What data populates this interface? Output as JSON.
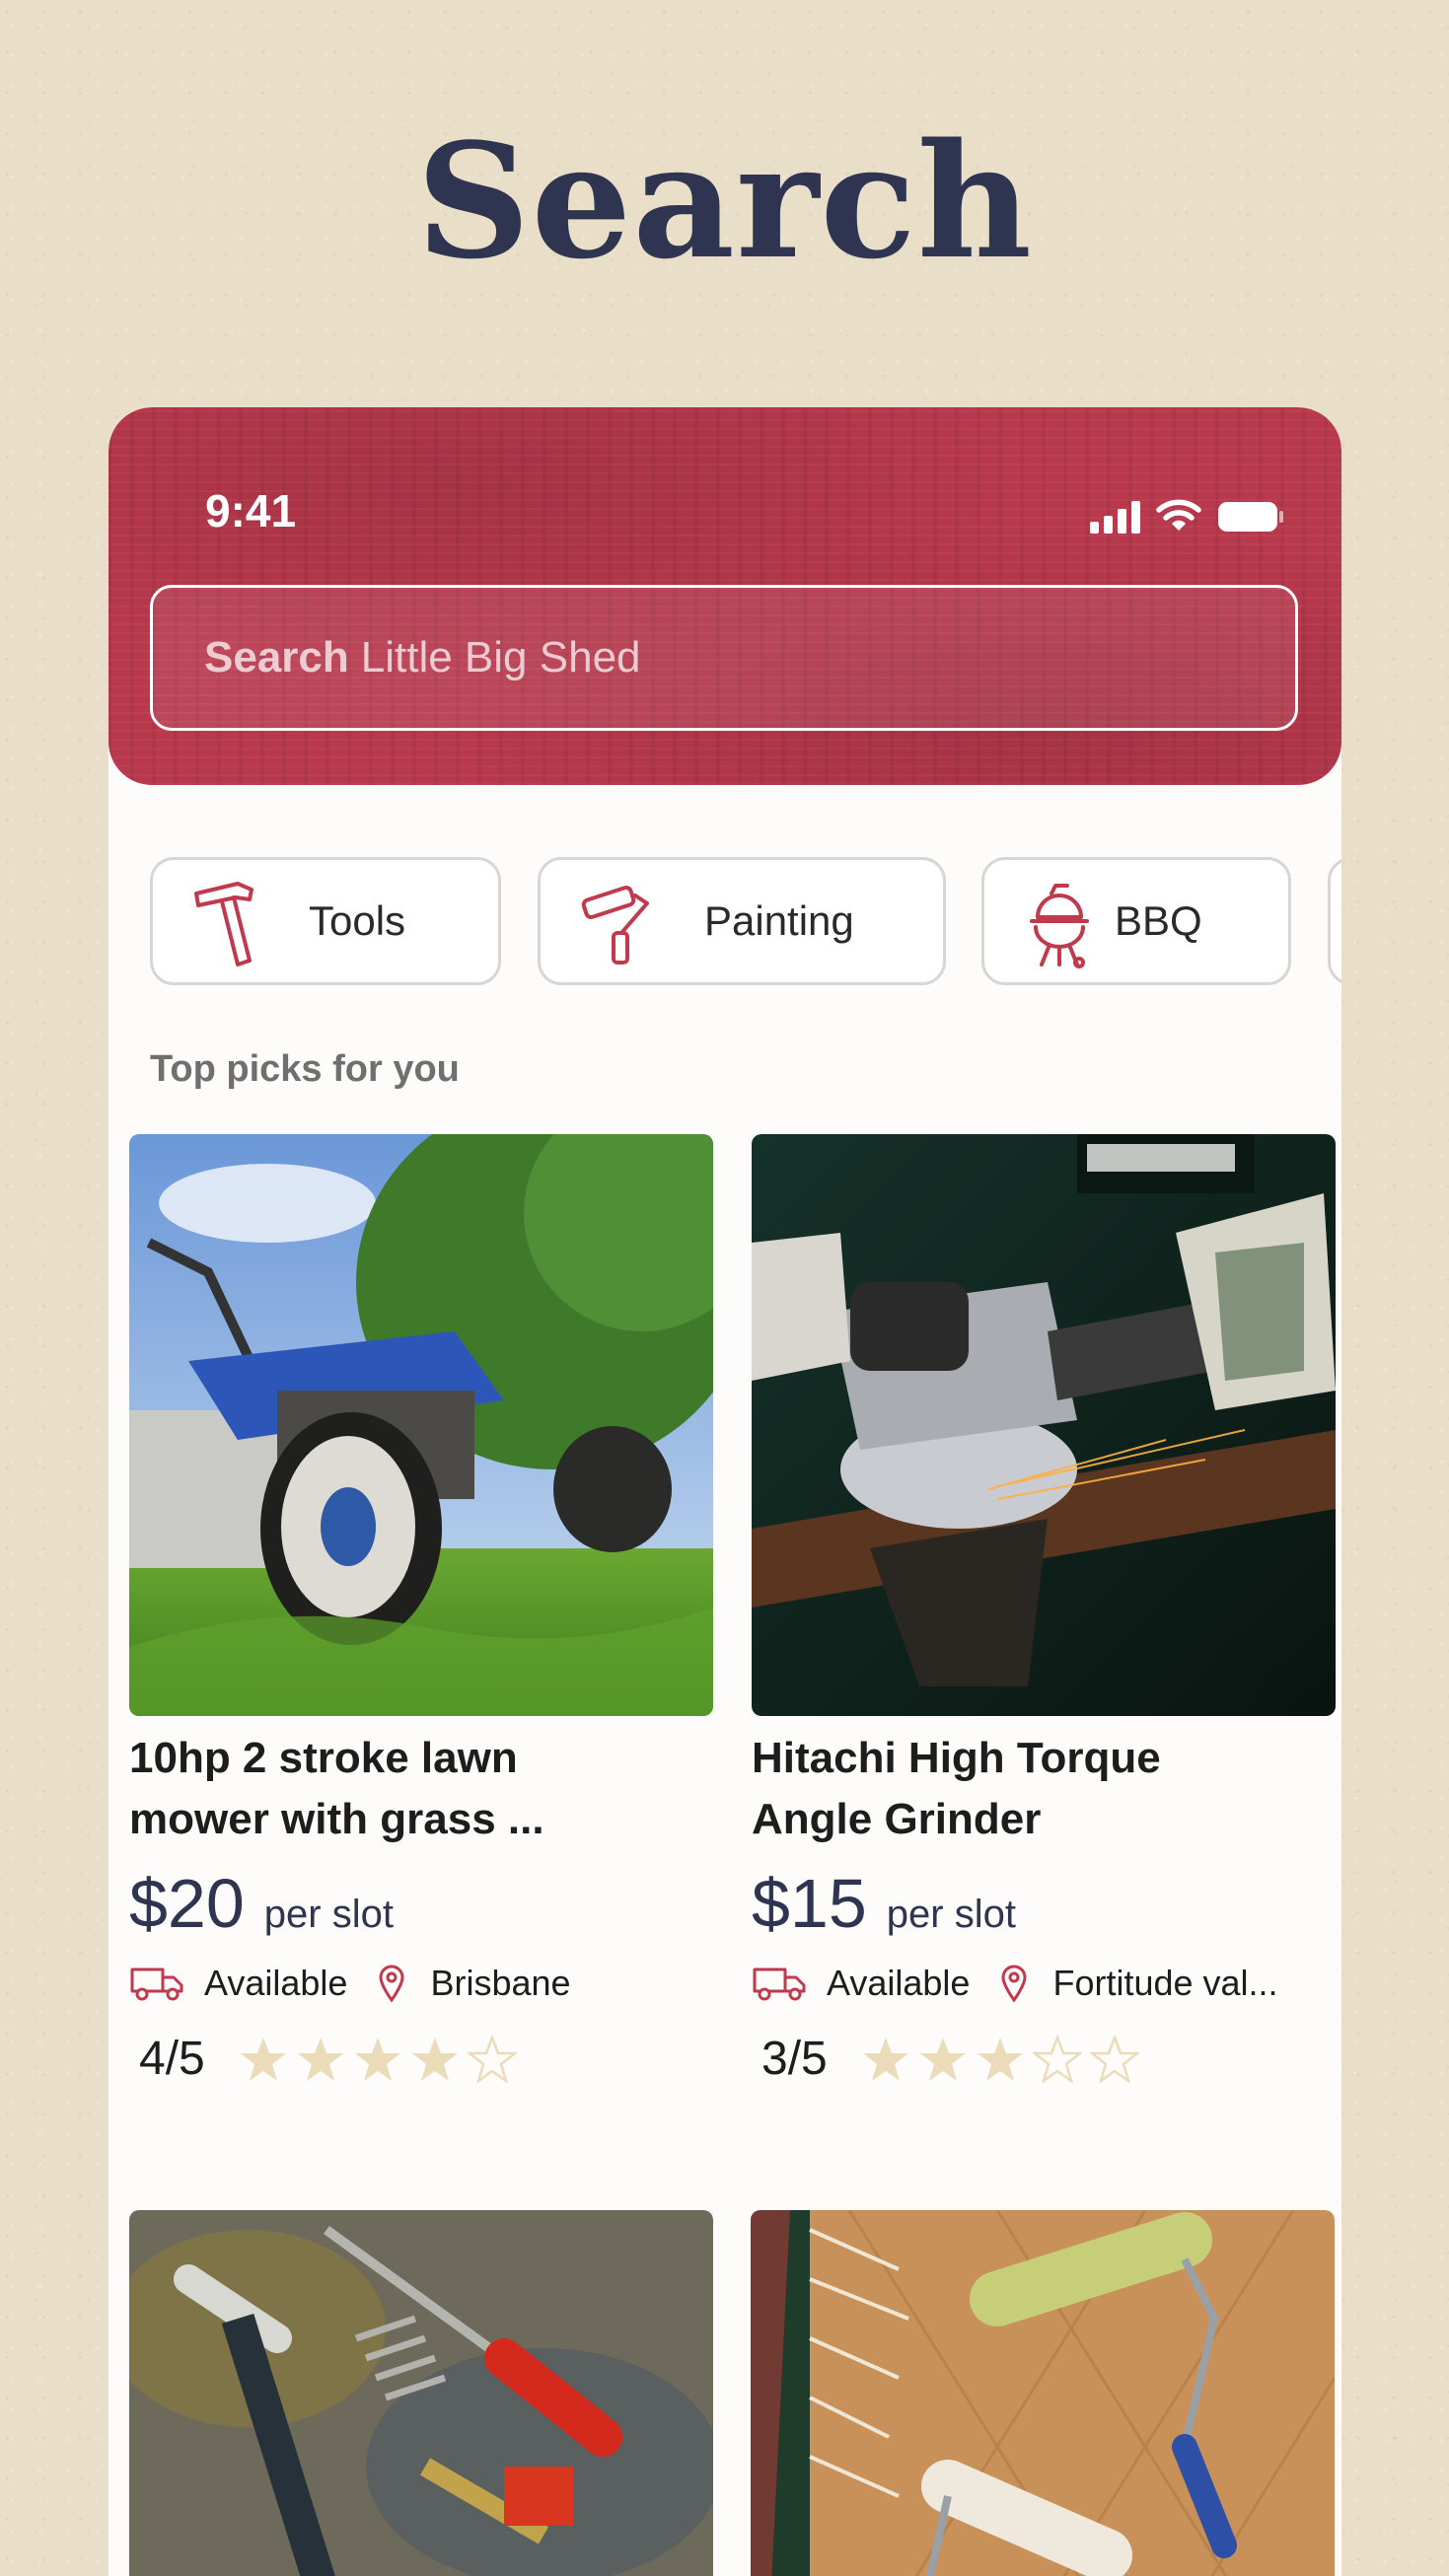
{
  "page": {
    "title": "Search"
  },
  "status_bar": {
    "time": "9:41"
  },
  "search": {
    "bold": "Search",
    "rest": "Little Big Shed"
  },
  "categories": [
    {
      "label": "Tools",
      "icon": "hammer-icon"
    },
    {
      "label": "Painting",
      "icon": "paint-roller-icon"
    },
    {
      "label": "BBQ",
      "icon": "bbq-grill-icon"
    }
  ],
  "section": {
    "title": "Top picks for you"
  },
  "listings": [
    {
      "title_line1": "10hp 2 stroke lawn",
      "title_line2": "mower with grass ...",
      "price": "$20",
      "per": "per slot",
      "availability": "Available",
      "location": "Brisbane",
      "rating": "4/5",
      "stars": 4,
      "image": "lawn-mower-photo"
    },
    {
      "title_line1": "Hitachi High Torque",
      "title_line2": "Angle Grinder",
      "price": "$15",
      "per": "per slot",
      "availability": "Available",
      "location": "Fortitude val...",
      "rating": "3/5",
      "stars": 3,
      "image": "angle-grinder-photo"
    }
  ],
  "more_listings": [
    {
      "image": "hand-tools-photo"
    },
    {
      "image": "paint-roller-photo"
    }
  ],
  "colors": {
    "accent": "#b8384c",
    "navy": "#2f3550",
    "star": "#eadcb9",
    "icon": "#c0394d"
  }
}
